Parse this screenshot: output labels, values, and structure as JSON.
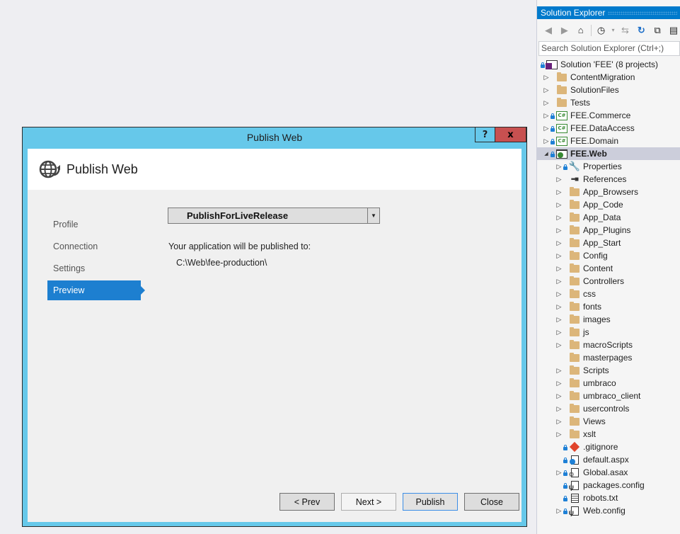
{
  "dialog": {
    "window_title": "Publish Web",
    "help_label": "?",
    "close_label": "x",
    "header_title": "Publish Web",
    "steps": [
      {
        "label": "Profile",
        "active": false
      },
      {
        "label": "Connection",
        "active": false
      },
      {
        "label": "Settings",
        "active": false
      },
      {
        "label": "Preview",
        "active": true
      }
    ],
    "profile_select": {
      "value": "PublishForLiveRelease"
    },
    "publish_info_label": "Your application will be published to:",
    "publish_path": "C:\\Web\\fee-production\\",
    "buttons": {
      "prev": "< Prev",
      "next": "Next >",
      "publish": "Publish",
      "close": "Close"
    }
  },
  "solution_explorer": {
    "title": "Solution Explorer",
    "toolbar_icons": [
      "back-icon",
      "forward-icon",
      "home-icon",
      "pending-changes-filter-icon",
      "sync-icon",
      "refresh-icon",
      "collapse-all-icon",
      "show-all-files-icon"
    ],
    "search_placeholder": "Search Solution Explorer (Ctrl+;)",
    "tree": [
      {
        "label": "Solution 'FEE' (8 projects)",
        "level": 0,
        "icon": "solution",
        "lock": true,
        "expander": "none"
      },
      {
        "label": "ContentMigration",
        "level": 1,
        "icon": "folder",
        "lock": false,
        "expander": "collapsed"
      },
      {
        "label": "SolutionFiles",
        "level": 1,
        "icon": "folder",
        "lock": false,
        "expander": "collapsed"
      },
      {
        "label": "Tests",
        "level": 1,
        "icon": "folder",
        "lock": false,
        "expander": "collapsed"
      },
      {
        "label": "FEE.Commerce",
        "level": 1,
        "icon": "csproj",
        "lock": true,
        "expander": "collapsed"
      },
      {
        "label": "FEE.DataAccess",
        "level": 1,
        "icon": "csproj",
        "lock": true,
        "expander": "collapsed"
      },
      {
        "label": "FEE.Domain",
        "level": 1,
        "icon": "csproj",
        "lock": true,
        "expander": "collapsed"
      },
      {
        "label": "FEE.Web",
        "level": 1,
        "icon": "webproj",
        "lock": true,
        "expander": "expanded",
        "selected": true
      },
      {
        "label": "Properties",
        "level": 2,
        "icon": "wrench",
        "lock": true,
        "expander": "collapsed"
      },
      {
        "label": "References",
        "level": 2,
        "icon": "references",
        "lock": false,
        "expander": "collapsed"
      },
      {
        "label": "App_Browsers",
        "level": 2,
        "icon": "folder",
        "lock": false,
        "expander": "collapsed"
      },
      {
        "label": "App_Code",
        "level": 2,
        "icon": "folder",
        "lock": false,
        "expander": "collapsed"
      },
      {
        "label": "App_Data",
        "level": 2,
        "icon": "folder",
        "lock": false,
        "expander": "collapsed"
      },
      {
        "label": "App_Plugins",
        "level": 2,
        "icon": "folder",
        "lock": false,
        "expander": "collapsed"
      },
      {
        "label": "App_Start",
        "level": 2,
        "icon": "folder",
        "lock": false,
        "expander": "collapsed"
      },
      {
        "label": "Config",
        "level": 2,
        "icon": "folder",
        "lock": false,
        "expander": "collapsed"
      },
      {
        "label": "Content",
        "level": 2,
        "icon": "folder",
        "lock": false,
        "expander": "collapsed"
      },
      {
        "label": "Controllers",
        "level": 2,
        "icon": "folder",
        "lock": false,
        "expander": "collapsed"
      },
      {
        "label": "css",
        "level": 2,
        "icon": "folder",
        "lock": false,
        "expander": "collapsed"
      },
      {
        "label": "fonts",
        "level": 2,
        "icon": "folder",
        "lock": false,
        "expander": "collapsed"
      },
      {
        "label": "images",
        "level": 2,
        "icon": "folder",
        "lock": false,
        "expander": "collapsed"
      },
      {
        "label": "js",
        "level": 2,
        "icon": "folder",
        "lock": false,
        "expander": "collapsed"
      },
      {
        "label": "macroScripts",
        "level": 2,
        "icon": "folder",
        "lock": false,
        "expander": "collapsed"
      },
      {
        "label": "masterpages",
        "level": 2,
        "icon": "folder",
        "lock": false,
        "expander": "none"
      },
      {
        "label": "Scripts",
        "level": 2,
        "icon": "folder",
        "lock": false,
        "expander": "collapsed"
      },
      {
        "label": "umbraco",
        "level": 2,
        "icon": "folder",
        "lock": false,
        "expander": "collapsed"
      },
      {
        "label": "umbraco_client",
        "level": 2,
        "icon": "folder",
        "lock": false,
        "expander": "collapsed"
      },
      {
        "label": "usercontrols",
        "level": 2,
        "icon": "folder",
        "lock": false,
        "expander": "collapsed"
      },
      {
        "label": "Views",
        "level": 2,
        "icon": "folder",
        "lock": false,
        "expander": "collapsed"
      },
      {
        "label": "xslt",
        "level": 2,
        "icon": "folder",
        "lock": false,
        "expander": "collapsed"
      },
      {
        "label": ".gitignore",
        "level": 2,
        "icon": "git",
        "lock": true,
        "expander": "none"
      },
      {
        "label": "default.aspx",
        "level": 2,
        "icon": "aspx",
        "lock": true,
        "expander": "none"
      },
      {
        "label": "Global.asax",
        "level": 2,
        "icon": "asax",
        "lock": true,
        "expander": "collapsed"
      },
      {
        "label": "packages.config",
        "level": 2,
        "icon": "config",
        "lock": true,
        "expander": "none"
      },
      {
        "label": "robots.txt",
        "level": 2,
        "icon": "txt",
        "lock": true,
        "expander": "none"
      },
      {
        "label": "Web.config",
        "level": 2,
        "icon": "config",
        "lock": true,
        "expander": "collapsed"
      }
    ]
  }
}
